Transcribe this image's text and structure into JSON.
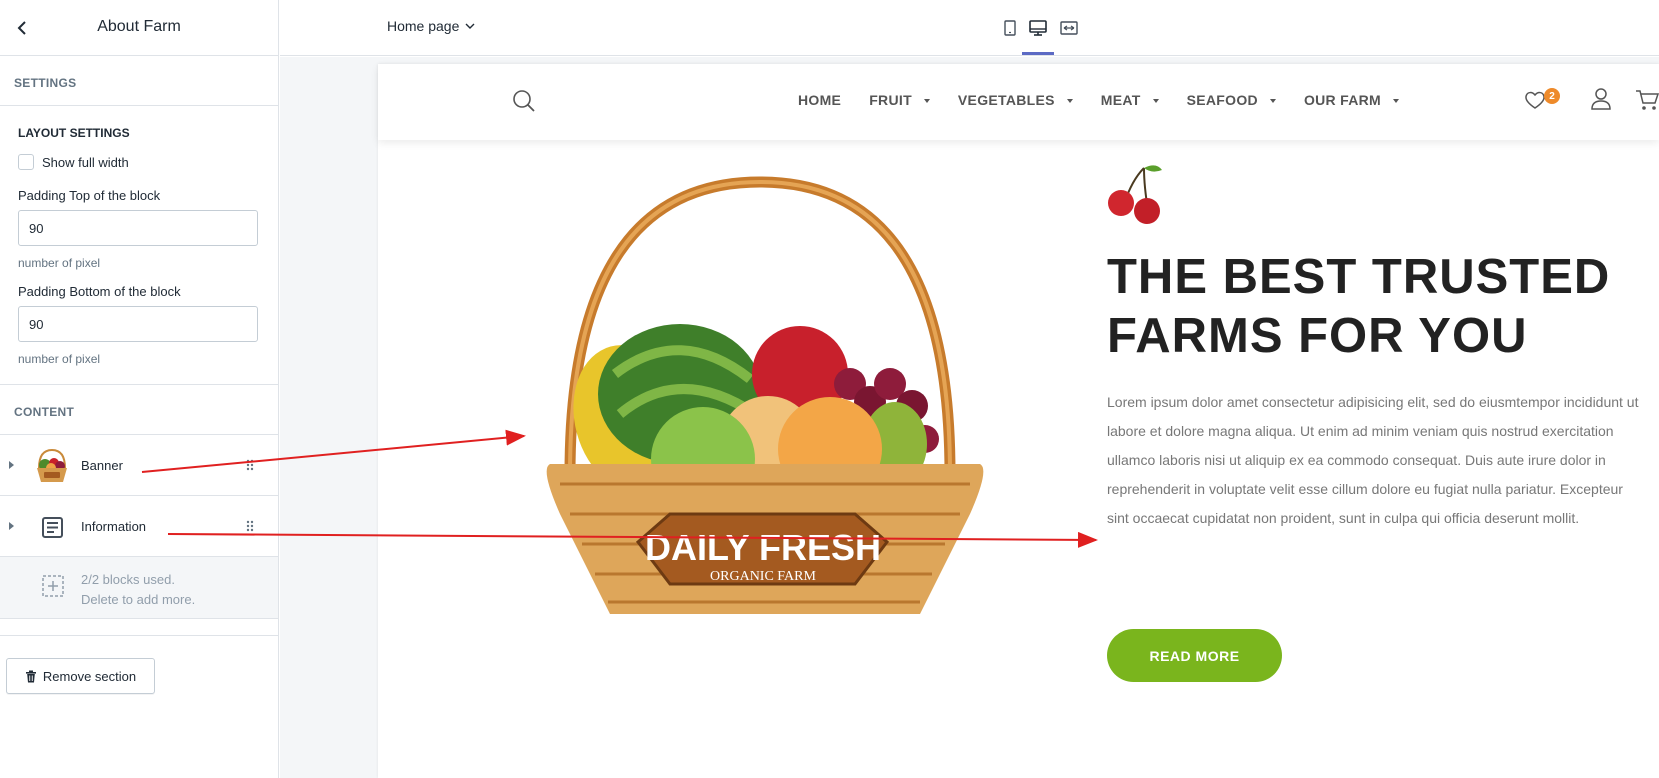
{
  "sidebar": {
    "title": "About Farm",
    "settings_heading": "SETTINGS",
    "layout": {
      "title": "LAYOUT SETTINGS",
      "full_width_label": "Show full width",
      "full_width_checked": false,
      "padding_top_label": "Padding Top of the block",
      "padding_top_value": "90",
      "padding_top_help": "number of pixel",
      "padding_bottom_label": "Padding Bottom of the block",
      "padding_bottom_value": "90",
      "padding_bottom_help": "number of pixel"
    },
    "content_heading": "CONTENT",
    "blocks": [
      {
        "label": "Banner",
        "icon": "fruit-basket-thumbnail"
      },
      {
        "label": "Information",
        "icon": "text-block-icon"
      }
    ],
    "blocks_used_line1": "2/2 blocks used.",
    "blocks_used_line2": "Delete to add more.",
    "remove_label": "Remove section"
  },
  "topbar": {
    "page_selector": "Home page",
    "devices": [
      "mobile-icon",
      "desktop-icon",
      "fullscreen-icon"
    ],
    "active_device": "desktop-icon",
    "accent_color": "#5c6ac4"
  },
  "store": {
    "nav": [
      {
        "label": "HOME",
        "dropdown": false
      },
      {
        "label": "FRUIT",
        "dropdown": true
      },
      {
        "label": "VEGETABLES",
        "dropdown": true
      },
      {
        "label": "MEAT",
        "dropdown": true
      },
      {
        "label": "SEAFOOD",
        "dropdown": true
      },
      {
        "label": "OUR FARM",
        "dropdown": true
      }
    ],
    "wishlist_count": "2",
    "banner_sign_line1": "DAILY FRESH",
    "banner_sign_line2": "ORGANIC FARM",
    "heading_line1": "THE BEST TRUSTED",
    "heading_line2": "FARMS FOR YOU",
    "paragraph": "Lorem ipsum dolor amet consectetur adipisicing elit, sed do eiusmtempor incididunt ut labore et dolore magna aliqua. Ut enim ad minim veniam quis nostrud exercitation ullamco laboris nisi ut aliquip ex ea commodo consequat. Duis aute irure dolor in reprehenderit in voluptate velit esse cillum dolore eu fugiat nulla pariatur. Excepteur sint occaecat cupidatat non proident, sunt in culpa qui officia deserunt mollit.",
    "cta_label": "READ MORE",
    "cta_color": "#7ab51d",
    "badge_color": "#ee8a2a"
  }
}
